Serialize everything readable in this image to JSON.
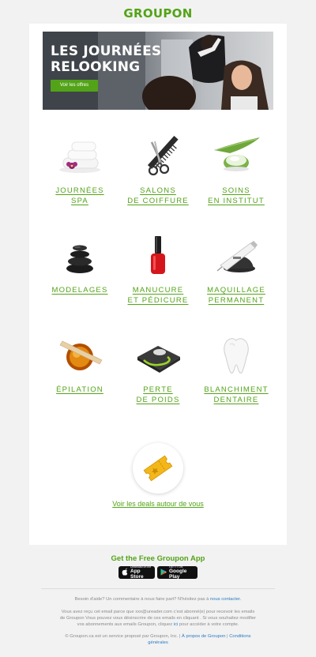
{
  "brand": {
    "logo": "GROUPON"
  },
  "hero": {
    "title_line1": "LES JOURNÉES",
    "title_line2": "RELOOKING",
    "button": "Voir les offres"
  },
  "categories": [
    {
      "line1": "JOURNÉES",
      "line2": "SPA",
      "icon": "towels-orchid-icon"
    },
    {
      "line1": "SALONS",
      "line2": "DE COIFFURE",
      "icon": "scissors-comb-icon"
    },
    {
      "line1": "SOINS",
      "line2": "EN INSTITUT",
      "icon": "cream-aloe-icon"
    },
    {
      "line1": "MODELAGES",
      "line2": "",
      "icon": "hot-stones-icon"
    },
    {
      "line1": "MANUCURE",
      "line2": "ET PÉDICURE",
      "icon": "nail-polish-icon"
    },
    {
      "line1": "MAQUILLAGE",
      "line2": "PERMANENT",
      "icon": "tattoo-machine-icon"
    },
    {
      "line1": "ÉPILATION",
      "line2": "",
      "icon": "wax-pot-icon"
    },
    {
      "line1": "PERTE",
      "line2": "DE POIDS",
      "icon": "scale-tape-icon"
    },
    {
      "line1": "BLANCHIMENT",
      "line2": "DENTAIRE",
      "icon": "tooth-icon"
    }
  ],
  "deals": {
    "icon": "ticket-icon",
    "link": "Voir les deals autour de vous"
  },
  "app": {
    "title": "Get the Free Groupon App",
    "appstore_small": "Download on the",
    "appstore_big": "App Store",
    "google_small": "GET IT ON",
    "google_big": "Google Play"
  },
  "footer": {
    "help_text": "Besoin d'aide? Un commentaire à nous faire part? N'hésitez pas à",
    "help_link": "nous contacter.",
    "notice_1": "Vous avez reçu cet email parce que xxx@ureader.com c'est abonné(e) pour recevoir les emails",
    "notice_2": "de Groupon Vous pouvez vous désinscrire de ces emails en cliquant . Si vous souhaitez modifier",
    "notice_3": "vos abonnements aux emails Groupon, cliquez",
    "notice_3_link": "ici",
    "notice_3_end": "pour accéder à votre compte.",
    "legal_text": "© Groupon.ca est un service proposé par Groupon, Inc.  |",
    "about_link": "À propos de Groupon",
    "sep": "|",
    "terms_1": "Conditions",
    "terms_2": "générales"
  },
  "colors": {
    "accent": "#53a318",
    "link": "#2a7cc0",
    "background": "#f2f2f2"
  }
}
